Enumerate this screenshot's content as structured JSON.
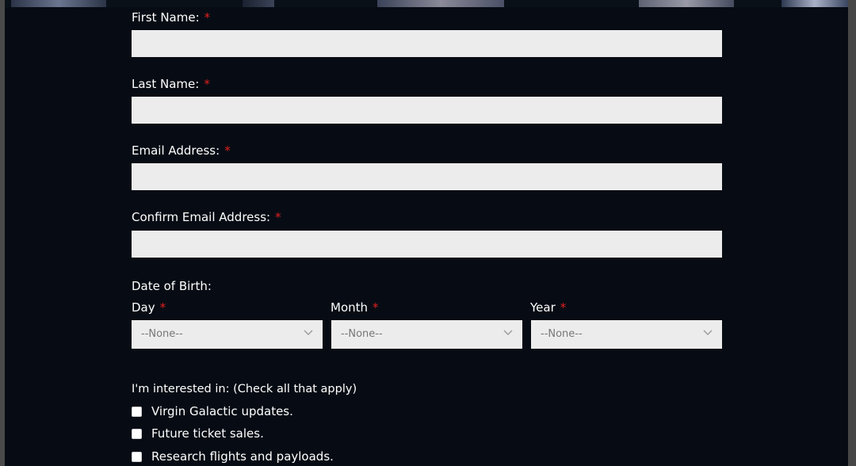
{
  "form": {
    "first_name": {
      "label": "First Name:",
      "required": "*",
      "value": ""
    },
    "last_name": {
      "label": "Last Name:",
      "required": "*",
      "value": ""
    },
    "email": {
      "label": "Email Address:",
      "required": "*",
      "value": ""
    },
    "confirm_email": {
      "label": "Confirm Email Address:",
      "required": "*",
      "value": ""
    },
    "dob": {
      "heading": "Date of Birth:",
      "day": {
        "label": "Day",
        "required": "*",
        "selected": "--None--"
      },
      "month": {
        "label": "Month",
        "required": "*",
        "selected": "--None--"
      },
      "year": {
        "label": "Year",
        "required": "*",
        "selected": "--None--"
      }
    },
    "interests": {
      "heading": "I'm interested in: (Check all that apply)",
      "options": [
        {
          "label": "Virgin Galactic updates.",
          "checked": false
        },
        {
          "label": "Future ticket sales.",
          "checked": false
        },
        {
          "label": "Research flights and payloads.",
          "checked": false
        }
      ]
    }
  },
  "colors": {
    "background": "#070c14",
    "input_bg": "#ececec",
    "required": "#e02020",
    "text": "#ffffff"
  }
}
